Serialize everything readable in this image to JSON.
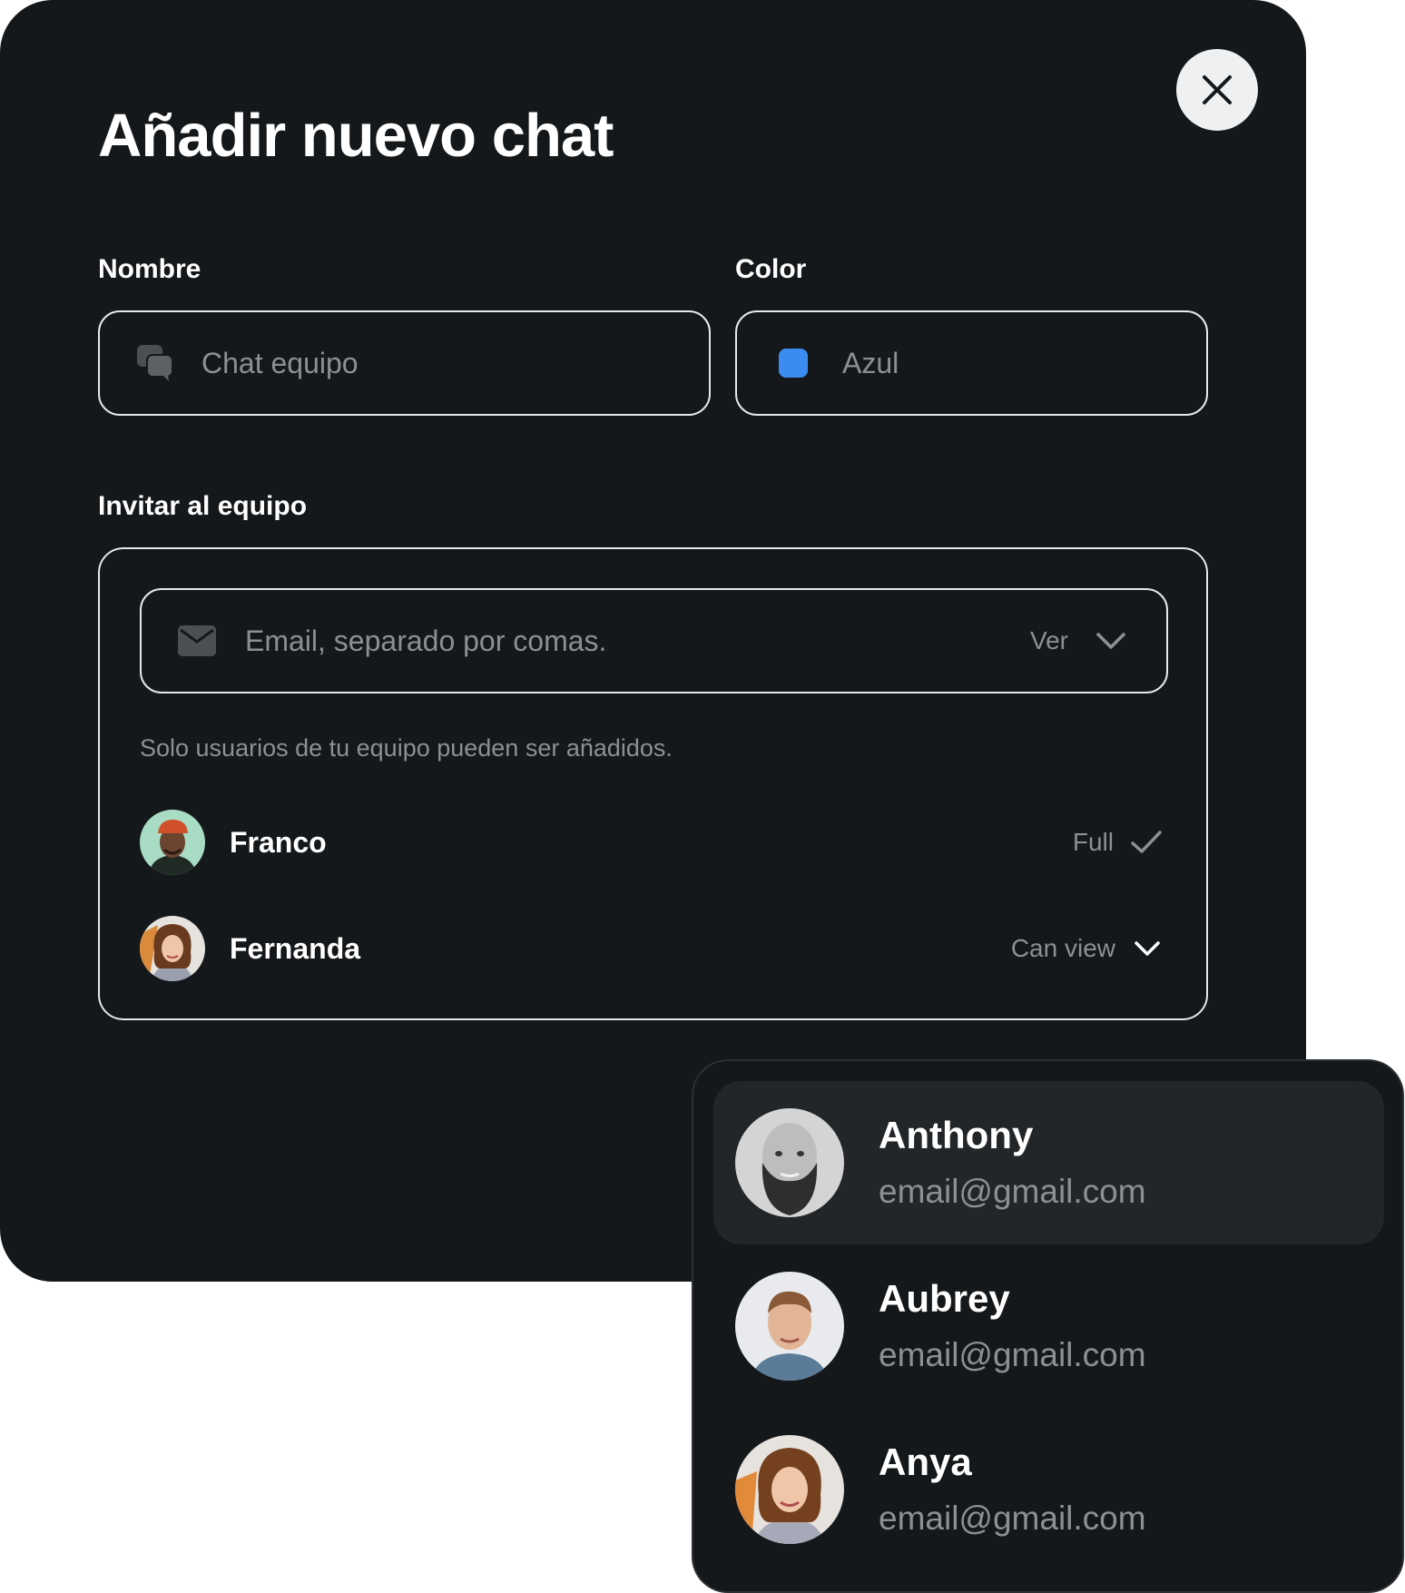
{
  "dialog": {
    "title": "Añadir nuevo chat",
    "close_label": "close"
  },
  "name_field": {
    "label": "Nombre",
    "placeholder": "Chat equipo",
    "icon": "chat-bubbles-icon"
  },
  "color_field": {
    "label": "Color",
    "value": "Azul",
    "swatch_color": "#3b8cf0"
  },
  "invite": {
    "label": "Invitar al equipo",
    "email_placeholder": "Email, separado por comas.",
    "email_icon": "envelope-icon",
    "permission_select": "Ver",
    "helper_text": "Solo usuarios de tu equipo pueden ser añadidos.",
    "members": [
      {
        "name": "Franco",
        "permission": "Full",
        "permission_icon": "check-icon"
      },
      {
        "name": "Fernanda",
        "permission": "Can view",
        "permission_icon": "chevron-down-icon"
      }
    ]
  },
  "suggestions": [
    {
      "name": "Anthony",
      "email": "email@gmail.com",
      "highlighted": true
    },
    {
      "name": "Aubrey",
      "email": "email@gmail.com",
      "highlighted": false
    },
    {
      "name": "Anya",
      "email": "email@gmail.com",
      "highlighted": false
    }
  ],
  "colors": {
    "modal_bg": "#15181a",
    "border": "#e6e8ea",
    "muted_text": "#8b9095",
    "accent_blue": "#3b8cf0",
    "highlight_bg": "#222628"
  }
}
